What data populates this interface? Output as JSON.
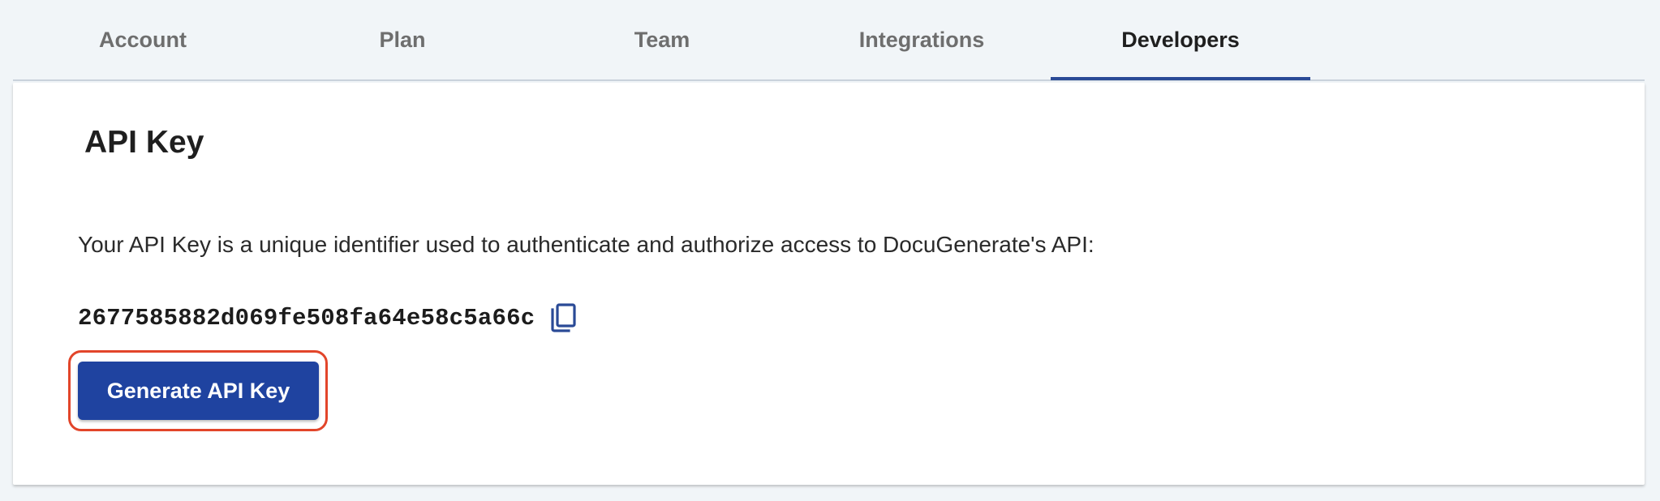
{
  "tabs": [
    {
      "label": "Account",
      "active": false
    },
    {
      "label": "Plan",
      "active": false
    },
    {
      "label": "Team",
      "active": false
    },
    {
      "label": "Integrations",
      "active": false
    },
    {
      "label": "Developers",
      "active": true
    }
  ],
  "api_key_section": {
    "title": "API Key",
    "description": "Your API Key is a unique identifier used to authenticate and authorize access to DocuGenerate's API:",
    "key_value": "2677585882d069fe508fa64e58c5a66c",
    "copy_icon": "copy-icon",
    "generate_button_label": "Generate API Key"
  },
  "colors": {
    "accent": "#1f43a0",
    "tab_indicator": "#2a4a96",
    "highlight_outline": "#e2452a",
    "background": "#f1f5f8"
  }
}
